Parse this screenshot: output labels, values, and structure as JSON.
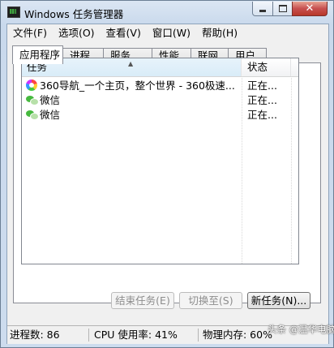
{
  "window": {
    "title": "Windows 任务管理器",
    "controls": {
      "close_glyph": "✕"
    }
  },
  "menu": [
    {
      "label": "文件(F)"
    },
    {
      "label": "选项(O)"
    },
    {
      "label": "查看(V)"
    },
    {
      "label": "窗口(W)"
    },
    {
      "label": "帮助(H)"
    }
  ],
  "tabs": [
    {
      "label": "应用程序",
      "active": true
    },
    {
      "label": "进程"
    },
    {
      "label": "服务"
    },
    {
      "label": "性能"
    },
    {
      "label": "联网"
    },
    {
      "label": "用户"
    }
  ],
  "table": {
    "columns": {
      "task": "任务",
      "status": "状态"
    },
    "sort_indicator": "▲",
    "rows": [
      {
        "name": "360导航_一个主页，整个世界 - 360极速...",
        "status": "正在...",
        "icon": "browser-icon"
      },
      {
        "name": "微信",
        "status": "正在...",
        "icon": "wechat-icon"
      },
      {
        "name": "微信",
        "status": "正在...",
        "icon": "wechat-icon"
      }
    ]
  },
  "buttons": {
    "end_task": "结束任务(E)",
    "switch_to": "切换至(S)",
    "new_task": "新任务(N)..."
  },
  "statusbar": {
    "processes": "进程数: 86",
    "cpu": "CPU 使用率: 41%",
    "memory": "物理内存: 60%"
  },
  "watermark": "头条 @温华电脑"
}
